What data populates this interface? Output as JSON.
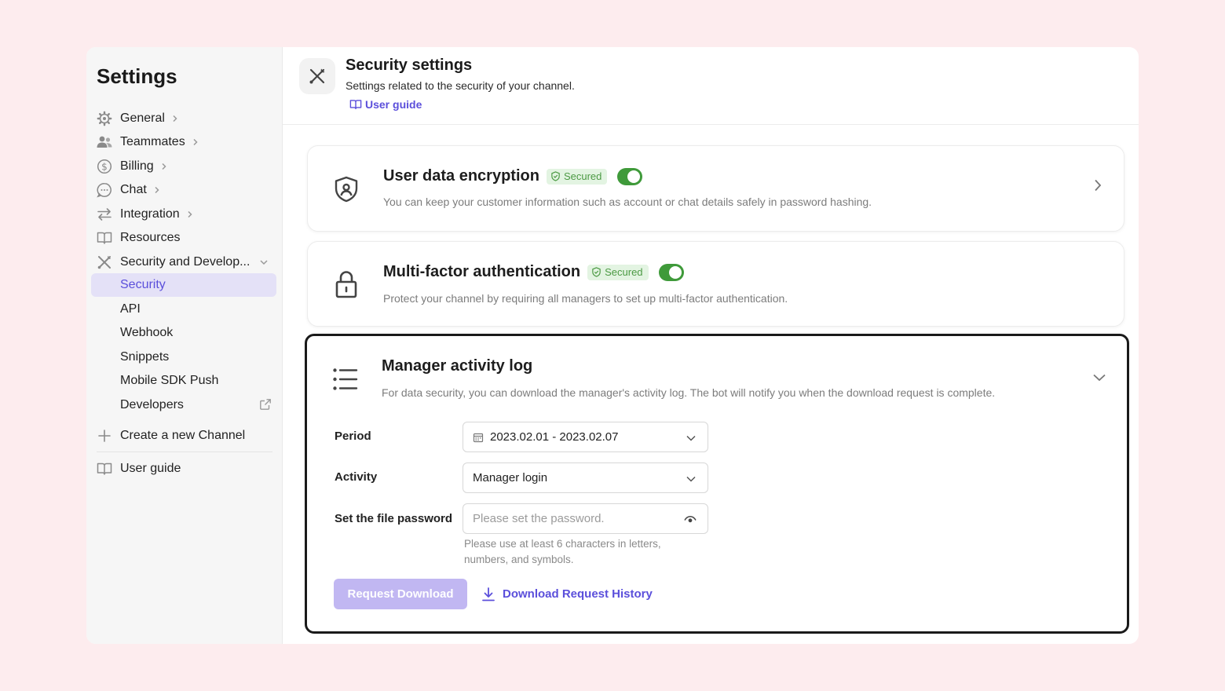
{
  "sidebar": {
    "title": "Settings",
    "items": [
      {
        "label": "General",
        "icon": "gear-icon"
      },
      {
        "label": "Teammates",
        "icon": "people-icon"
      },
      {
        "label": "Billing",
        "icon": "dollar-icon"
      },
      {
        "label": "Chat",
        "icon": "chat-icon"
      },
      {
        "label": "Integration",
        "icon": "arrows-icon"
      },
      {
        "label": "Resources",
        "icon": "book-icon"
      },
      {
        "label": "Security and Develop...",
        "icon": "tools-icon"
      }
    ],
    "sub_items": [
      "Security",
      "API",
      "Webhook",
      "Snippets",
      "Mobile SDK Push",
      "Developers"
    ],
    "create_channel": "Create a new Channel",
    "user_guide": "User guide"
  },
  "header": {
    "title": "Security settings",
    "subtitle": "Settings related to the security of your channel.",
    "link": "User guide"
  },
  "cards": {
    "encryption": {
      "title": "User data encryption",
      "badge": "Secured",
      "enabled": true,
      "description": "You can keep your customer information such as account or chat details safely in password hashing."
    },
    "mfa": {
      "title": "Multi-factor authentication",
      "badge": "Secured",
      "enabled": true,
      "description": "Protect your channel by requiring all managers to set up multi-factor authentication."
    },
    "log": {
      "title": "Manager activity log",
      "description": "For data security, you can download the manager's activity log. The bot will notify you when the download request is complete.",
      "period_label": "Period",
      "period_value": "2023.02.01 - 2023.02.07",
      "activity_label": "Activity",
      "activity_value": "Manager login",
      "password_label": "Set the file password",
      "password_placeholder": "Please set the password.",
      "password_hint": "Please use at least 6 characters in letters, numbers, and symbols.",
      "request_button": "Request Download",
      "history_link": "Download Request History"
    }
  },
  "colors": {
    "accent": "#5b4fdb",
    "active_bg": "#e4e1f7",
    "secured_bg": "#e3f4e2",
    "secured_text": "#4c9a44",
    "toggle_on": "#3f9a3a",
    "disabled_button": "#c1b7f2",
    "page_bg": "#fdecee"
  }
}
